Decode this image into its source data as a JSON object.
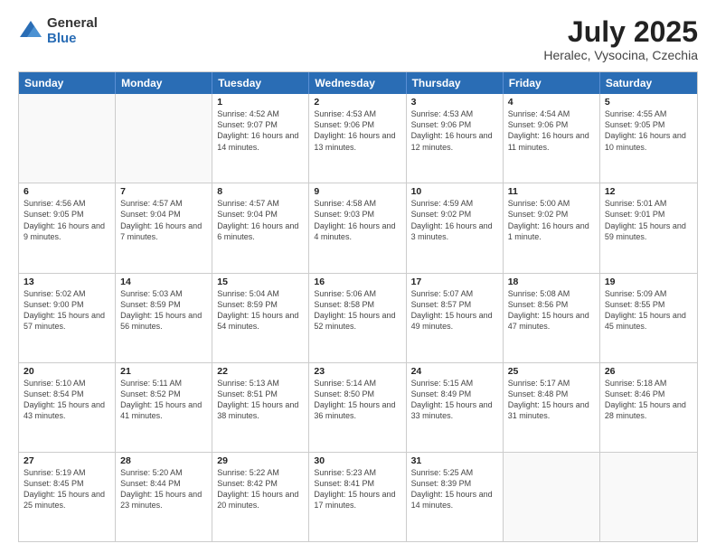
{
  "logo": {
    "general": "General",
    "blue": "Blue"
  },
  "title": "July 2025",
  "subtitle": "Heralec, Vysocina, Czechia",
  "days": [
    "Sunday",
    "Monday",
    "Tuesday",
    "Wednesday",
    "Thursday",
    "Friday",
    "Saturday"
  ],
  "rows": [
    [
      {
        "date": "",
        "sunrise": "",
        "sunset": "",
        "daylight": "",
        "empty": true
      },
      {
        "date": "",
        "sunrise": "",
        "sunset": "",
        "daylight": "",
        "empty": true
      },
      {
        "date": "1",
        "sunrise": "Sunrise: 4:52 AM",
        "sunset": "Sunset: 9:07 PM",
        "daylight": "Daylight: 16 hours and 14 minutes.",
        "empty": false
      },
      {
        "date": "2",
        "sunrise": "Sunrise: 4:53 AM",
        "sunset": "Sunset: 9:06 PM",
        "daylight": "Daylight: 16 hours and 13 minutes.",
        "empty": false
      },
      {
        "date": "3",
        "sunrise": "Sunrise: 4:53 AM",
        "sunset": "Sunset: 9:06 PM",
        "daylight": "Daylight: 16 hours and 12 minutes.",
        "empty": false
      },
      {
        "date": "4",
        "sunrise": "Sunrise: 4:54 AM",
        "sunset": "Sunset: 9:06 PM",
        "daylight": "Daylight: 16 hours and 11 minutes.",
        "empty": false
      },
      {
        "date": "5",
        "sunrise": "Sunrise: 4:55 AM",
        "sunset": "Sunset: 9:05 PM",
        "daylight": "Daylight: 16 hours and 10 minutes.",
        "empty": false
      }
    ],
    [
      {
        "date": "6",
        "sunrise": "Sunrise: 4:56 AM",
        "sunset": "Sunset: 9:05 PM",
        "daylight": "Daylight: 16 hours and 9 minutes.",
        "empty": false
      },
      {
        "date": "7",
        "sunrise": "Sunrise: 4:57 AM",
        "sunset": "Sunset: 9:04 PM",
        "daylight": "Daylight: 16 hours and 7 minutes.",
        "empty": false
      },
      {
        "date": "8",
        "sunrise": "Sunrise: 4:57 AM",
        "sunset": "Sunset: 9:04 PM",
        "daylight": "Daylight: 16 hours and 6 minutes.",
        "empty": false
      },
      {
        "date": "9",
        "sunrise": "Sunrise: 4:58 AM",
        "sunset": "Sunset: 9:03 PM",
        "daylight": "Daylight: 16 hours and 4 minutes.",
        "empty": false
      },
      {
        "date": "10",
        "sunrise": "Sunrise: 4:59 AM",
        "sunset": "Sunset: 9:02 PM",
        "daylight": "Daylight: 16 hours and 3 minutes.",
        "empty": false
      },
      {
        "date": "11",
        "sunrise": "Sunrise: 5:00 AM",
        "sunset": "Sunset: 9:02 PM",
        "daylight": "Daylight: 16 hours and 1 minute.",
        "empty": false
      },
      {
        "date": "12",
        "sunrise": "Sunrise: 5:01 AM",
        "sunset": "Sunset: 9:01 PM",
        "daylight": "Daylight: 15 hours and 59 minutes.",
        "empty": false
      }
    ],
    [
      {
        "date": "13",
        "sunrise": "Sunrise: 5:02 AM",
        "sunset": "Sunset: 9:00 PM",
        "daylight": "Daylight: 15 hours and 57 minutes.",
        "empty": false
      },
      {
        "date": "14",
        "sunrise": "Sunrise: 5:03 AM",
        "sunset": "Sunset: 8:59 PM",
        "daylight": "Daylight: 15 hours and 56 minutes.",
        "empty": false
      },
      {
        "date": "15",
        "sunrise": "Sunrise: 5:04 AM",
        "sunset": "Sunset: 8:59 PM",
        "daylight": "Daylight: 15 hours and 54 minutes.",
        "empty": false
      },
      {
        "date": "16",
        "sunrise": "Sunrise: 5:06 AM",
        "sunset": "Sunset: 8:58 PM",
        "daylight": "Daylight: 15 hours and 52 minutes.",
        "empty": false
      },
      {
        "date": "17",
        "sunrise": "Sunrise: 5:07 AM",
        "sunset": "Sunset: 8:57 PM",
        "daylight": "Daylight: 15 hours and 49 minutes.",
        "empty": false
      },
      {
        "date": "18",
        "sunrise": "Sunrise: 5:08 AM",
        "sunset": "Sunset: 8:56 PM",
        "daylight": "Daylight: 15 hours and 47 minutes.",
        "empty": false
      },
      {
        "date": "19",
        "sunrise": "Sunrise: 5:09 AM",
        "sunset": "Sunset: 8:55 PM",
        "daylight": "Daylight: 15 hours and 45 minutes.",
        "empty": false
      }
    ],
    [
      {
        "date": "20",
        "sunrise": "Sunrise: 5:10 AM",
        "sunset": "Sunset: 8:54 PM",
        "daylight": "Daylight: 15 hours and 43 minutes.",
        "empty": false
      },
      {
        "date": "21",
        "sunrise": "Sunrise: 5:11 AM",
        "sunset": "Sunset: 8:52 PM",
        "daylight": "Daylight: 15 hours and 41 minutes.",
        "empty": false
      },
      {
        "date": "22",
        "sunrise": "Sunrise: 5:13 AM",
        "sunset": "Sunset: 8:51 PM",
        "daylight": "Daylight: 15 hours and 38 minutes.",
        "empty": false
      },
      {
        "date": "23",
        "sunrise": "Sunrise: 5:14 AM",
        "sunset": "Sunset: 8:50 PM",
        "daylight": "Daylight: 15 hours and 36 minutes.",
        "empty": false
      },
      {
        "date": "24",
        "sunrise": "Sunrise: 5:15 AM",
        "sunset": "Sunset: 8:49 PM",
        "daylight": "Daylight: 15 hours and 33 minutes.",
        "empty": false
      },
      {
        "date": "25",
        "sunrise": "Sunrise: 5:17 AM",
        "sunset": "Sunset: 8:48 PM",
        "daylight": "Daylight: 15 hours and 31 minutes.",
        "empty": false
      },
      {
        "date": "26",
        "sunrise": "Sunrise: 5:18 AM",
        "sunset": "Sunset: 8:46 PM",
        "daylight": "Daylight: 15 hours and 28 minutes.",
        "empty": false
      }
    ],
    [
      {
        "date": "27",
        "sunrise": "Sunrise: 5:19 AM",
        "sunset": "Sunset: 8:45 PM",
        "daylight": "Daylight: 15 hours and 25 minutes.",
        "empty": false
      },
      {
        "date": "28",
        "sunrise": "Sunrise: 5:20 AM",
        "sunset": "Sunset: 8:44 PM",
        "daylight": "Daylight: 15 hours and 23 minutes.",
        "empty": false
      },
      {
        "date": "29",
        "sunrise": "Sunrise: 5:22 AM",
        "sunset": "Sunset: 8:42 PM",
        "daylight": "Daylight: 15 hours and 20 minutes.",
        "empty": false
      },
      {
        "date": "30",
        "sunrise": "Sunrise: 5:23 AM",
        "sunset": "Sunset: 8:41 PM",
        "daylight": "Daylight: 15 hours and 17 minutes.",
        "empty": false
      },
      {
        "date": "31",
        "sunrise": "Sunrise: 5:25 AM",
        "sunset": "Sunset: 8:39 PM",
        "daylight": "Daylight: 15 hours and 14 minutes.",
        "empty": false
      },
      {
        "date": "",
        "sunrise": "",
        "sunset": "",
        "daylight": "",
        "empty": true
      },
      {
        "date": "",
        "sunrise": "",
        "sunset": "",
        "daylight": "",
        "empty": true
      }
    ]
  ]
}
